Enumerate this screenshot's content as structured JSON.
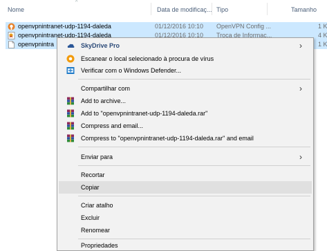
{
  "header": {
    "col_name": "Nome",
    "col_date": "Data de modificaç...",
    "col_type": "Tipo",
    "col_size": "Tamanho"
  },
  "files": [
    {
      "name": "openvpnintranet-udp-1194-daleda",
      "date": "01/12/2016 10:10",
      "type": "OpenVPN Config ...",
      "size": "1 KB"
    },
    {
      "name": "openvpnintranet-udp-1194-daleda",
      "date": "01/12/2016 10:10",
      "type": "Troca de Informac...",
      "size": "4 KB"
    },
    {
      "name": "openvpnintra",
      "size": "1 KB"
    }
  ],
  "menu": {
    "skydrive": "SkyDrive Pro",
    "scan": "Escanear o local selecionado à procura de vírus",
    "defender": "Verificar com o Windows Defender...",
    "share": "Compartilhar com",
    "add_archive": "Add to archive...",
    "add_rar": "Add to \"openvpnintranet-udp-1194-daleda.rar\"",
    "compress_email": "Compress and email...",
    "compress_rar_email": "Compress to \"openvpnintranet-udp-1194-daleda.rar\" and email",
    "send_to": "Enviar para",
    "cut": "Recortar",
    "copy": "Copiar",
    "shortcut": "Criar atalho",
    "delete": "Excluir",
    "rename": "Renomear",
    "properties": "Propriedades"
  },
  "colors": {
    "selection": "#cce8ff",
    "menu_bg": "#f2f2f2",
    "hover": "#e0e0e0",
    "header_text": "#4c607a"
  }
}
